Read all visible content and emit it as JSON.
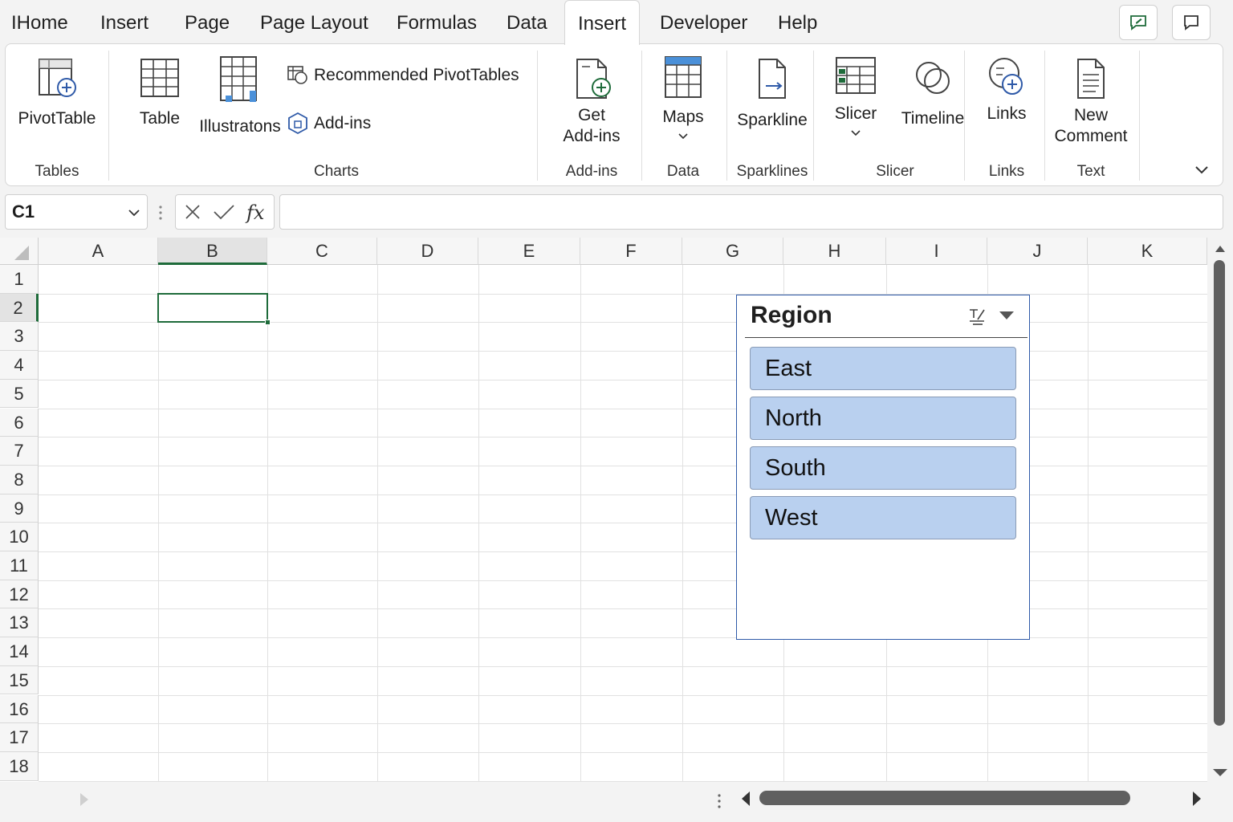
{
  "menu": {
    "tabs": [
      {
        "label": "IHome",
        "active": false
      },
      {
        "label": "Insert",
        "active": false
      },
      {
        "label": "Page",
        "active": false
      },
      {
        "label": "Page Layout",
        "active": false
      },
      {
        "label": "Formulas",
        "active": false
      },
      {
        "label": "Data",
        "active": false
      },
      {
        "label": "Insert",
        "active": true
      },
      {
        "label": "Developer",
        "active": false
      },
      {
        "label": "Help",
        "active": false
      }
    ]
  },
  "ribbon": {
    "pivottable": "PivotTable",
    "table": "Table",
    "illustrations": "Illustratons",
    "recommended_pivottables": "Recommended PivotTables",
    "addins": "Add-ins",
    "get_addins_line1": "Get",
    "get_addins_line2": "Add-ins",
    "maps": "Maps",
    "sparkline": "Sparkline",
    "slicer": "Slicer",
    "timeline": "Timeline",
    "links": "Links",
    "new_comment_line1": "New",
    "new_comment_line2": "Comment",
    "groups": {
      "tables": "Tables",
      "charts": "Charts",
      "addins": "Add-ins",
      "data": "Data",
      "sparklines": "Sparklines",
      "slicer": "Slicer",
      "links": "Links",
      "text": "Text"
    }
  },
  "formula_bar": {
    "name_box": "C1",
    "formula": ""
  },
  "grid": {
    "columns": [
      "A",
      "B",
      "C",
      "D",
      "E",
      "F",
      "G",
      "H",
      "I",
      "J",
      "K"
    ],
    "rows": [
      "1",
      "2",
      "3",
      "4",
      "5",
      "6",
      "7",
      "8",
      "9",
      "10",
      "11",
      "12",
      "13",
      "14",
      "15",
      "16",
      "17",
      "18"
    ],
    "selected_column": "B",
    "selected_row": "2"
  },
  "slicer": {
    "title": "Region",
    "items": [
      "East",
      "North",
      "South",
      "West"
    ]
  },
  "colors": {
    "accent_green": "#1e6b3a",
    "slicer_item_fill": "#b9d0ef",
    "slicer_border": "#2f5aa8"
  }
}
